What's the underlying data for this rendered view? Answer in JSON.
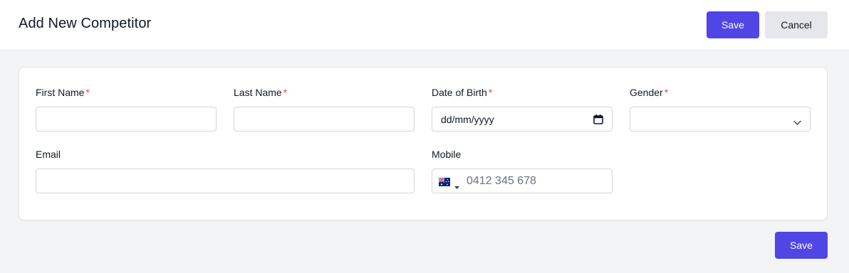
{
  "header": {
    "title": "Add New Competitor",
    "save_label": "Save",
    "cancel_label": "Cancel"
  },
  "form": {
    "first_name": {
      "label": "First Name",
      "required_mark": "*",
      "value": ""
    },
    "last_name": {
      "label": "Last Name",
      "required_mark": "*",
      "value": ""
    },
    "date_of_birth": {
      "label": "Date of Birth",
      "required_mark": "*",
      "placeholder": "dd/mm/yyyy",
      "icon": "calendar-icon"
    },
    "gender": {
      "label": "Gender",
      "required_mark": "*",
      "selected": "",
      "icon": "chevron-down-icon"
    },
    "email": {
      "label": "Email",
      "value": ""
    },
    "mobile": {
      "label": "Mobile",
      "placeholder": "0412 345 678",
      "country_flag": "australia-flag-icon"
    }
  },
  "footer": {
    "save_label": "Save"
  },
  "colors": {
    "primary": "#4f46e5",
    "required": "#ef4444",
    "background": "#f3f4f6",
    "secondary_button": "#e5e7eb"
  }
}
